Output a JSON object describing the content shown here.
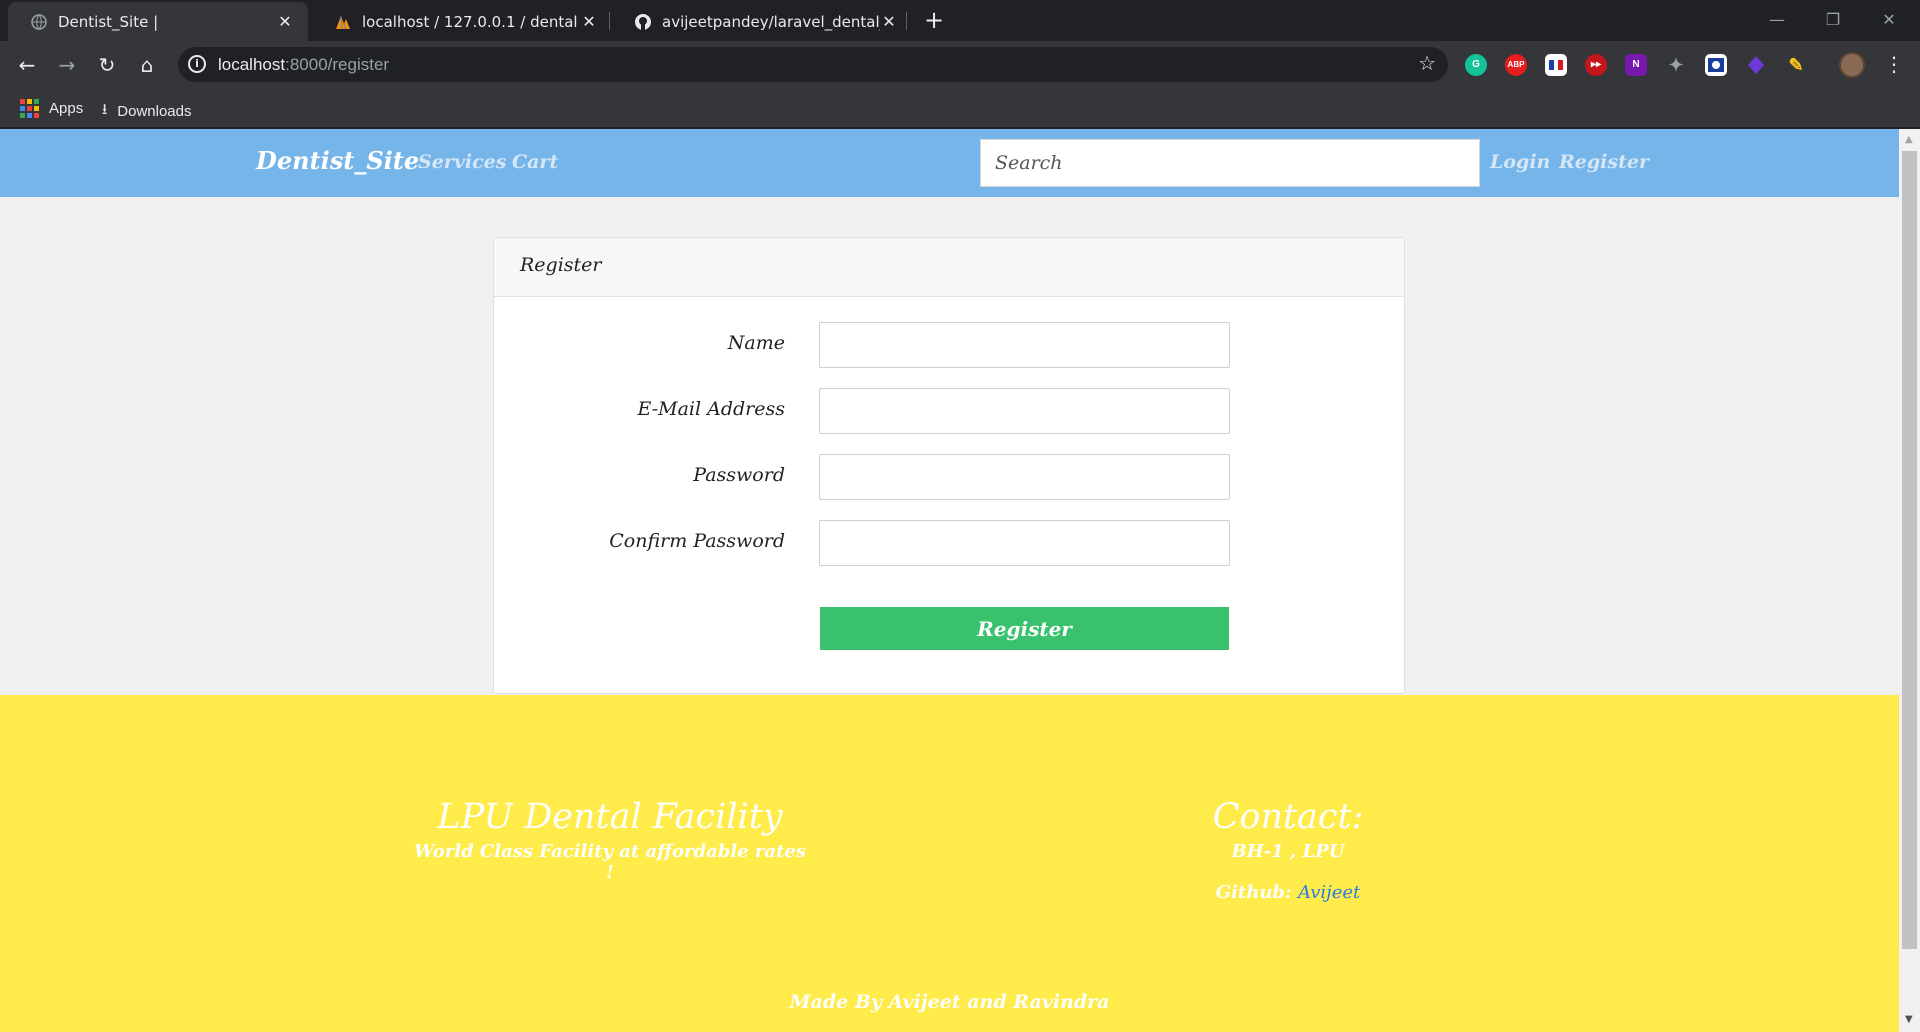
{
  "browser": {
    "tabs": [
      {
        "title": "Dentist_Site |",
        "active": true,
        "icon": "globe-icon"
      },
      {
        "title": "localhost / 127.0.0.1 / dental | ph",
        "active": false,
        "icon": "phpmyadmin-icon"
      },
      {
        "title": "avijeetpandey/laravel_dental_site",
        "active": false,
        "icon": "github-icon"
      }
    ],
    "url_host": "localhost",
    "url_rest": ":8000/register",
    "bookmarks": {
      "apps": "Apps",
      "downloads": "Downloads"
    },
    "extensions": [
      "G",
      "ABP",
      "",
      "",
      "N",
      "",
      "",
      "",
      ""
    ]
  },
  "site": {
    "brand": "Dentist_Site",
    "nav": {
      "services": "Services",
      "cart": "Cart",
      "login": "Login",
      "register": "Register"
    },
    "search_placeholder": "Search"
  },
  "form": {
    "title": "Register",
    "fields": {
      "name": "Name",
      "email": "E-Mail Address",
      "password": "Password",
      "confirm": "Confirm Password"
    },
    "submit": "Register"
  },
  "footer": {
    "heading": "LPU Dental Facility",
    "tagline": "World Class Facility at affordable rates !",
    "contact_heading": "Contact:",
    "address": "BH-1 , LPU",
    "github_label": "Github:",
    "github_link": "Avijeet",
    "credits": "Made By Avijeet and Ravindra"
  },
  "colors": {
    "navbar": "#75b5ea",
    "footer": "#ffeb4a",
    "button": "#39c16d",
    "link": "#2a7de1"
  }
}
